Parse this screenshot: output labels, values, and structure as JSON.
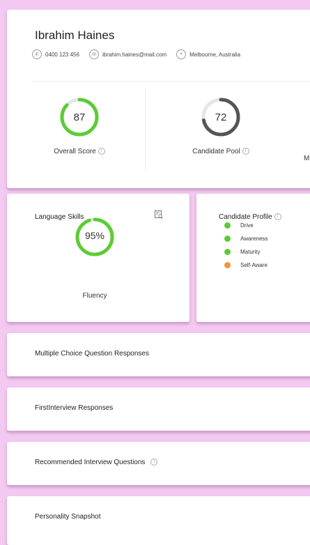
{
  "candidate": {
    "name": "Ibrahim Haines",
    "phone": "0400 123 456",
    "email": "ibrahim.haines@mail.com",
    "location": "Melbourne, Australia"
  },
  "scores": [
    {
      "label": "Overall Score",
      "value": "87",
      "fraction": 0.87,
      "color": "#5ccc35"
    },
    {
      "label": "Candidate Pool",
      "value": "72",
      "fraction": 0.72,
      "color": "#555555"
    }
  ],
  "scores_overflow_label": "M",
  "language_skills": {
    "title": "Language Skills",
    "fluency_value": "95%",
    "fluency_fraction": 0.95,
    "fluency_label": "Fluency",
    "color": "#5ccc35"
  },
  "candidate_profile": {
    "title": "Candidate Profile",
    "items": [
      {
        "label": "Drive",
        "color": "#5ccc35"
      },
      {
        "label": "Awareness",
        "color": "#5ccc35"
      },
      {
        "label": "Maturity",
        "color": "#5ccc35"
      },
      {
        "label": "Self-Aware",
        "color": "#f5923a"
      }
    ]
  },
  "sections": [
    {
      "title": "Multiple Choice Question Responses"
    },
    {
      "title": "FirstInterview Responses"
    },
    {
      "title": "Recommended Interview Questions"
    },
    {
      "title": "Personality Snapshot"
    }
  ],
  "icons": {
    "phone": "phone-icon",
    "email": "email-icon",
    "location": "location-icon",
    "info": "info-icon",
    "language_report": "report-icon"
  }
}
